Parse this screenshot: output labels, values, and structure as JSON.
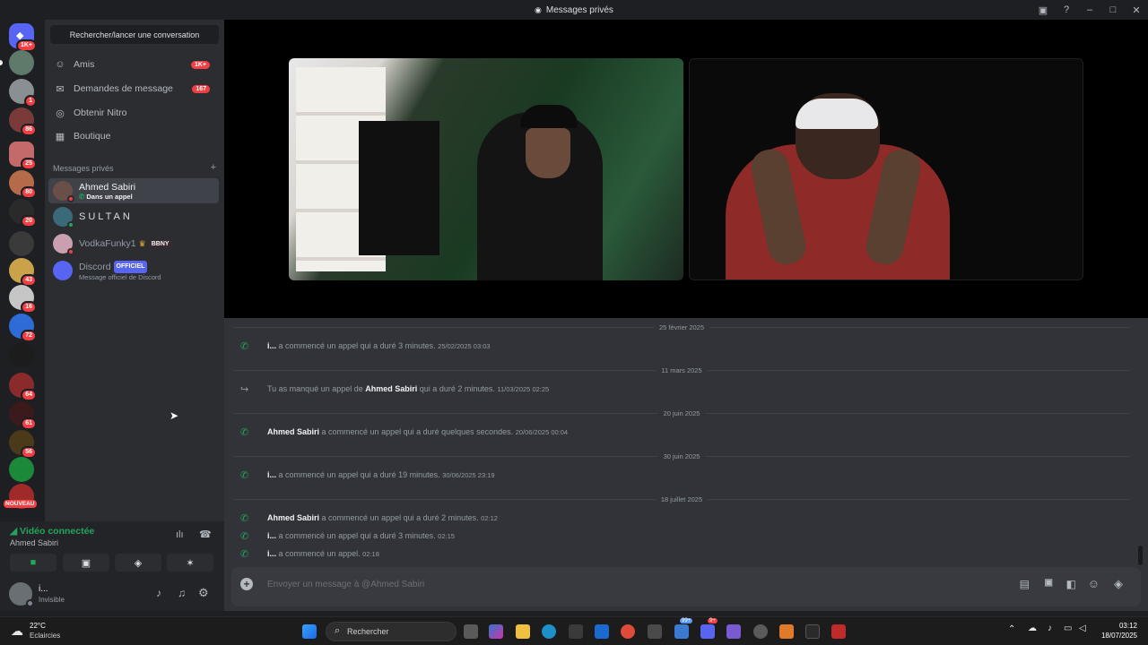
{
  "window": {
    "title": "Messages privés"
  },
  "rail": {
    "home_badge": "1K+",
    "servers": [
      {
        "badge": "1"
      },
      {
        "badge": "86"
      },
      {
        "badge": "25"
      },
      {
        "badge": "80"
      },
      {
        "badge": "20"
      },
      {
        "badge": ""
      },
      {
        "badge": "43"
      },
      {
        "badge": "16"
      },
      {
        "badge": "72"
      },
      {
        "badge": ""
      },
      {
        "badge": "64"
      },
      {
        "badge": "61"
      },
      {
        "badge": "56"
      },
      {
        "badge": ""
      }
    ],
    "new_label": "NOUVEAU"
  },
  "sidebar": {
    "search_label": "Rechercher/lancer une conversation",
    "nav": [
      {
        "label": "Amis",
        "count": "1K+"
      },
      {
        "label": "Demandes de message",
        "count": "167"
      },
      {
        "label": "Obtenir Nitro",
        "count": ""
      },
      {
        "label": "Boutique",
        "count": ""
      }
    ],
    "dm_header": "Messages privés",
    "dm_add": "+",
    "dms": [
      {
        "name": "Ahmed Sabiri",
        "sub": "Dans un appel"
      },
      {
        "name": "SULTAN",
        "sub": ""
      },
      {
        "name": "VodkaFunky1",
        "tag": "BBNY"
      },
      {
        "name": "Discord",
        "tag": "OFFICIEL",
        "sub": "Message officiel de Discord"
      }
    ]
  },
  "voice": {
    "status": "Vidéo connectée",
    "channel": "Ahmed Sabiri"
  },
  "user": {
    "name": "i...",
    "status": "Invisible"
  },
  "chat": {
    "dividers": [
      "25 février 2025",
      "11 mars 2025",
      "20 juin 2025",
      "30 juin 2025",
      "18 juillet 2025"
    ],
    "messages": [
      {
        "author": "i...",
        "text": "a commencé un appel qui a duré 3 minutes.",
        "time": "25/02/2025 03:03"
      },
      {
        "pre": "Tu as manqué un appel de",
        "author": "Ahmed Sabiri",
        "text": "qui a duré 2 minutes.",
        "time": "11/03/2025 02:25"
      },
      {
        "author": "Ahmed Sabiri",
        "text": "a commencé un appel qui a duré quelques secondes.",
        "time": "20/06/2025 00:04"
      },
      {
        "author": "i...",
        "text": "a commencé un appel qui a duré 19 minutes.",
        "time": "30/06/2025 23:19"
      },
      {
        "author": "Ahmed Sabiri",
        "text": "a commencé un appel qui a duré 2 minutes.",
        "time": "02:12"
      },
      {
        "author": "i...",
        "text": "a commencé un appel qui a duré 3 minutes.",
        "time": "02:15"
      },
      {
        "author": "i...",
        "text": "a commencé un appel.",
        "time": "02:18"
      }
    ],
    "input_placeholder": "Envoyer un message à @Ahmed Sabiri"
  },
  "taskbar": {
    "weather_temp": "22°C",
    "weather_desc": "Eclaircies",
    "search_label": "Rechercher",
    "badge_a": "99+",
    "badge_b": "9+",
    "time": "03:12",
    "date": "18/07/2025"
  },
  "colors": {
    "accent": "#5865f2",
    "green": "#23a55a",
    "red": "#f23f43"
  }
}
